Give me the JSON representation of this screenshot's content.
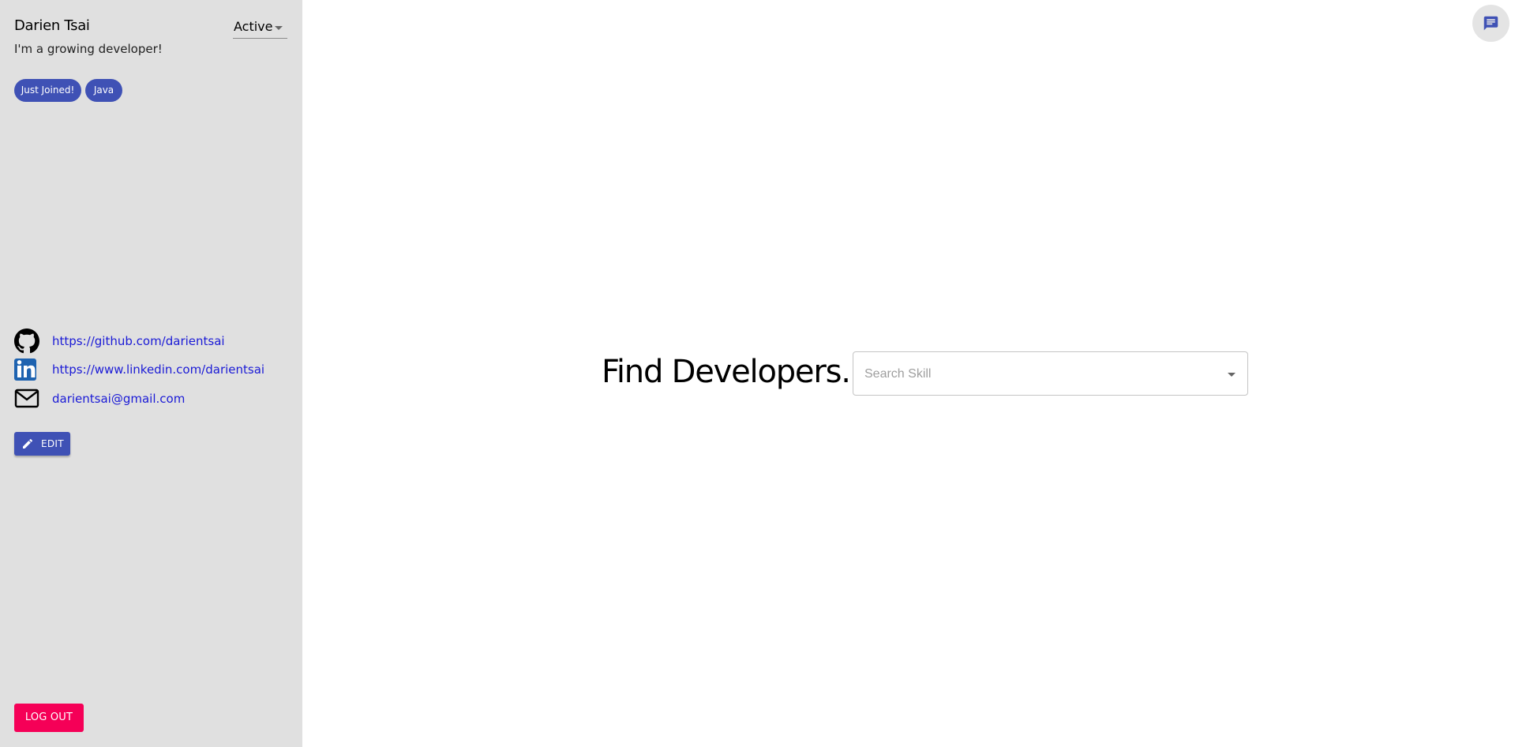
{
  "profile": {
    "name": "Darien Tsai",
    "status": "Active",
    "bio": "I'm a growing developer!",
    "tags": [
      "Just Joined!",
      "Java"
    ]
  },
  "links": {
    "github": "https://github.com/darientsai",
    "linkedin": "https://www.linkedin.com/darientsai",
    "email": "darientsai@gmail.com"
  },
  "buttons": {
    "edit": "EDIT",
    "logout": "LOG OUT"
  },
  "main": {
    "title": "Find Developers.",
    "search_placeholder": "Search Skill"
  },
  "colors": {
    "primary": "#3f51b5",
    "secondary": "#f50057",
    "sidebar_bg": "#e0e0e0",
    "link": "#1a1ad6"
  },
  "icons": {
    "github": "github-icon",
    "linkedin": "linkedin-icon",
    "email": "mail-icon",
    "edit": "pencil-icon",
    "chat": "chat-icon"
  }
}
